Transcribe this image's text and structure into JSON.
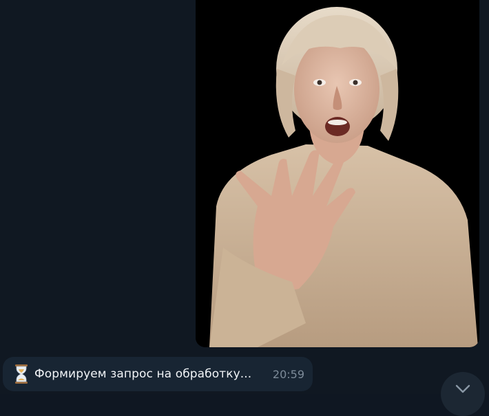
{
  "message": {
    "text": "Формируем запрос на обработку...",
    "time": "20:59",
    "icon": "hourglass-icon"
  },
  "photo": {
    "subject": "photo-of-surprised-woman"
  },
  "controls": {
    "scroll_down_icon": "chevron-down-icon"
  },
  "colors": {
    "background": "#101822",
    "bubble": "#182533",
    "text": "#f1f4f7",
    "time": "#7d8b99"
  }
}
